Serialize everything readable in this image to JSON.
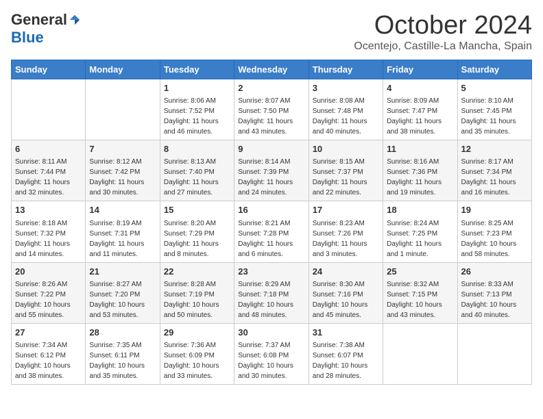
{
  "logo": {
    "general": "General",
    "blue": "Blue"
  },
  "header": {
    "month": "October 2024",
    "location": "Ocentejo, Castille-La Mancha, Spain"
  },
  "weekdays": [
    "Sunday",
    "Monday",
    "Tuesday",
    "Wednesday",
    "Thursday",
    "Friday",
    "Saturday"
  ],
  "weeks": [
    [
      {
        "day": "",
        "info": ""
      },
      {
        "day": "",
        "info": ""
      },
      {
        "day": "1",
        "info": "Sunrise: 8:06 AM\nSunset: 7:52 PM\nDaylight: 11 hours and 46 minutes."
      },
      {
        "day": "2",
        "info": "Sunrise: 8:07 AM\nSunset: 7:50 PM\nDaylight: 11 hours and 43 minutes."
      },
      {
        "day": "3",
        "info": "Sunrise: 8:08 AM\nSunset: 7:48 PM\nDaylight: 11 hours and 40 minutes."
      },
      {
        "day": "4",
        "info": "Sunrise: 8:09 AM\nSunset: 7:47 PM\nDaylight: 11 hours and 38 minutes."
      },
      {
        "day": "5",
        "info": "Sunrise: 8:10 AM\nSunset: 7:45 PM\nDaylight: 11 hours and 35 minutes."
      }
    ],
    [
      {
        "day": "6",
        "info": "Sunrise: 8:11 AM\nSunset: 7:44 PM\nDaylight: 11 hours and 32 minutes."
      },
      {
        "day": "7",
        "info": "Sunrise: 8:12 AM\nSunset: 7:42 PM\nDaylight: 11 hours and 30 minutes."
      },
      {
        "day": "8",
        "info": "Sunrise: 8:13 AM\nSunset: 7:40 PM\nDaylight: 11 hours and 27 minutes."
      },
      {
        "day": "9",
        "info": "Sunrise: 8:14 AM\nSunset: 7:39 PM\nDaylight: 11 hours and 24 minutes."
      },
      {
        "day": "10",
        "info": "Sunrise: 8:15 AM\nSunset: 7:37 PM\nDaylight: 11 hours and 22 minutes."
      },
      {
        "day": "11",
        "info": "Sunrise: 8:16 AM\nSunset: 7:36 PM\nDaylight: 11 hours and 19 minutes."
      },
      {
        "day": "12",
        "info": "Sunrise: 8:17 AM\nSunset: 7:34 PM\nDaylight: 11 hours and 16 minutes."
      }
    ],
    [
      {
        "day": "13",
        "info": "Sunrise: 8:18 AM\nSunset: 7:32 PM\nDaylight: 11 hours and 14 minutes."
      },
      {
        "day": "14",
        "info": "Sunrise: 8:19 AM\nSunset: 7:31 PM\nDaylight: 11 hours and 11 minutes."
      },
      {
        "day": "15",
        "info": "Sunrise: 8:20 AM\nSunset: 7:29 PM\nDaylight: 11 hours and 8 minutes."
      },
      {
        "day": "16",
        "info": "Sunrise: 8:21 AM\nSunset: 7:28 PM\nDaylight: 11 hours and 6 minutes."
      },
      {
        "day": "17",
        "info": "Sunrise: 8:23 AM\nSunset: 7:26 PM\nDaylight: 11 hours and 3 minutes."
      },
      {
        "day": "18",
        "info": "Sunrise: 8:24 AM\nSunset: 7:25 PM\nDaylight: 11 hours and 1 minute."
      },
      {
        "day": "19",
        "info": "Sunrise: 8:25 AM\nSunset: 7:23 PM\nDaylight: 10 hours and 58 minutes."
      }
    ],
    [
      {
        "day": "20",
        "info": "Sunrise: 8:26 AM\nSunset: 7:22 PM\nDaylight: 10 hours and 55 minutes."
      },
      {
        "day": "21",
        "info": "Sunrise: 8:27 AM\nSunset: 7:20 PM\nDaylight: 10 hours and 53 minutes."
      },
      {
        "day": "22",
        "info": "Sunrise: 8:28 AM\nSunset: 7:19 PM\nDaylight: 10 hours and 50 minutes."
      },
      {
        "day": "23",
        "info": "Sunrise: 8:29 AM\nSunset: 7:18 PM\nDaylight: 10 hours and 48 minutes."
      },
      {
        "day": "24",
        "info": "Sunrise: 8:30 AM\nSunset: 7:16 PM\nDaylight: 10 hours and 45 minutes."
      },
      {
        "day": "25",
        "info": "Sunrise: 8:32 AM\nSunset: 7:15 PM\nDaylight: 10 hours and 43 minutes."
      },
      {
        "day": "26",
        "info": "Sunrise: 8:33 AM\nSunset: 7:13 PM\nDaylight: 10 hours and 40 minutes."
      }
    ],
    [
      {
        "day": "27",
        "info": "Sunrise: 7:34 AM\nSunset: 6:12 PM\nDaylight: 10 hours and 38 minutes."
      },
      {
        "day": "28",
        "info": "Sunrise: 7:35 AM\nSunset: 6:11 PM\nDaylight: 10 hours and 35 minutes."
      },
      {
        "day": "29",
        "info": "Sunrise: 7:36 AM\nSunset: 6:09 PM\nDaylight: 10 hours and 33 minutes."
      },
      {
        "day": "30",
        "info": "Sunrise: 7:37 AM\nSunset: 6:08 PM\nDaylight: 10 hours and 30 minutes."
      },
      {
        "day": "31",
        "info": "Sunrise: 7:38 AM\nSunset: 6:07 PM\nDaylight: 10 hours and 28 minutes."
      },
      {
        "day": "",
        "info": ""
      },
      {
        "day": "",
        "info": ""
      }
    ]
  ]
}
